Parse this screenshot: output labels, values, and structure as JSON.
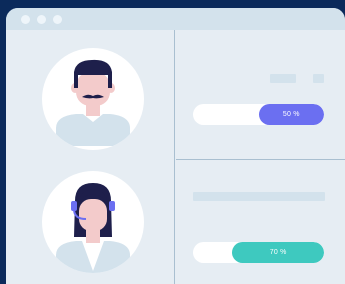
{
  "window": {
    "title_dots": [
      "dot",
      "dot",
      "dot"
    ]
  },
  "users": [
    {
      "avatar_icon": "male-user-icon"
    },
    {
      "avatar_icon": "female-support-agent-icon"
    }
  ],
  "cards": [
    {
      "progress": 0.5,
      "progress_label": "50 %",
      "color": "#6b6ff1"
    },
    {
      "progress": 0.7,
      "progress_label": "70 %",
      "color": "#3ec9bf"
    }
  ],
  "colors": {
    "background": "#0b2a5b",
    "window": "#e6edf3",
    "titlebar": "#d3e2ec",
    "accent_purple": "#6b6ff1",
    "accent_teal": "#3ec9bf"
  }
}
